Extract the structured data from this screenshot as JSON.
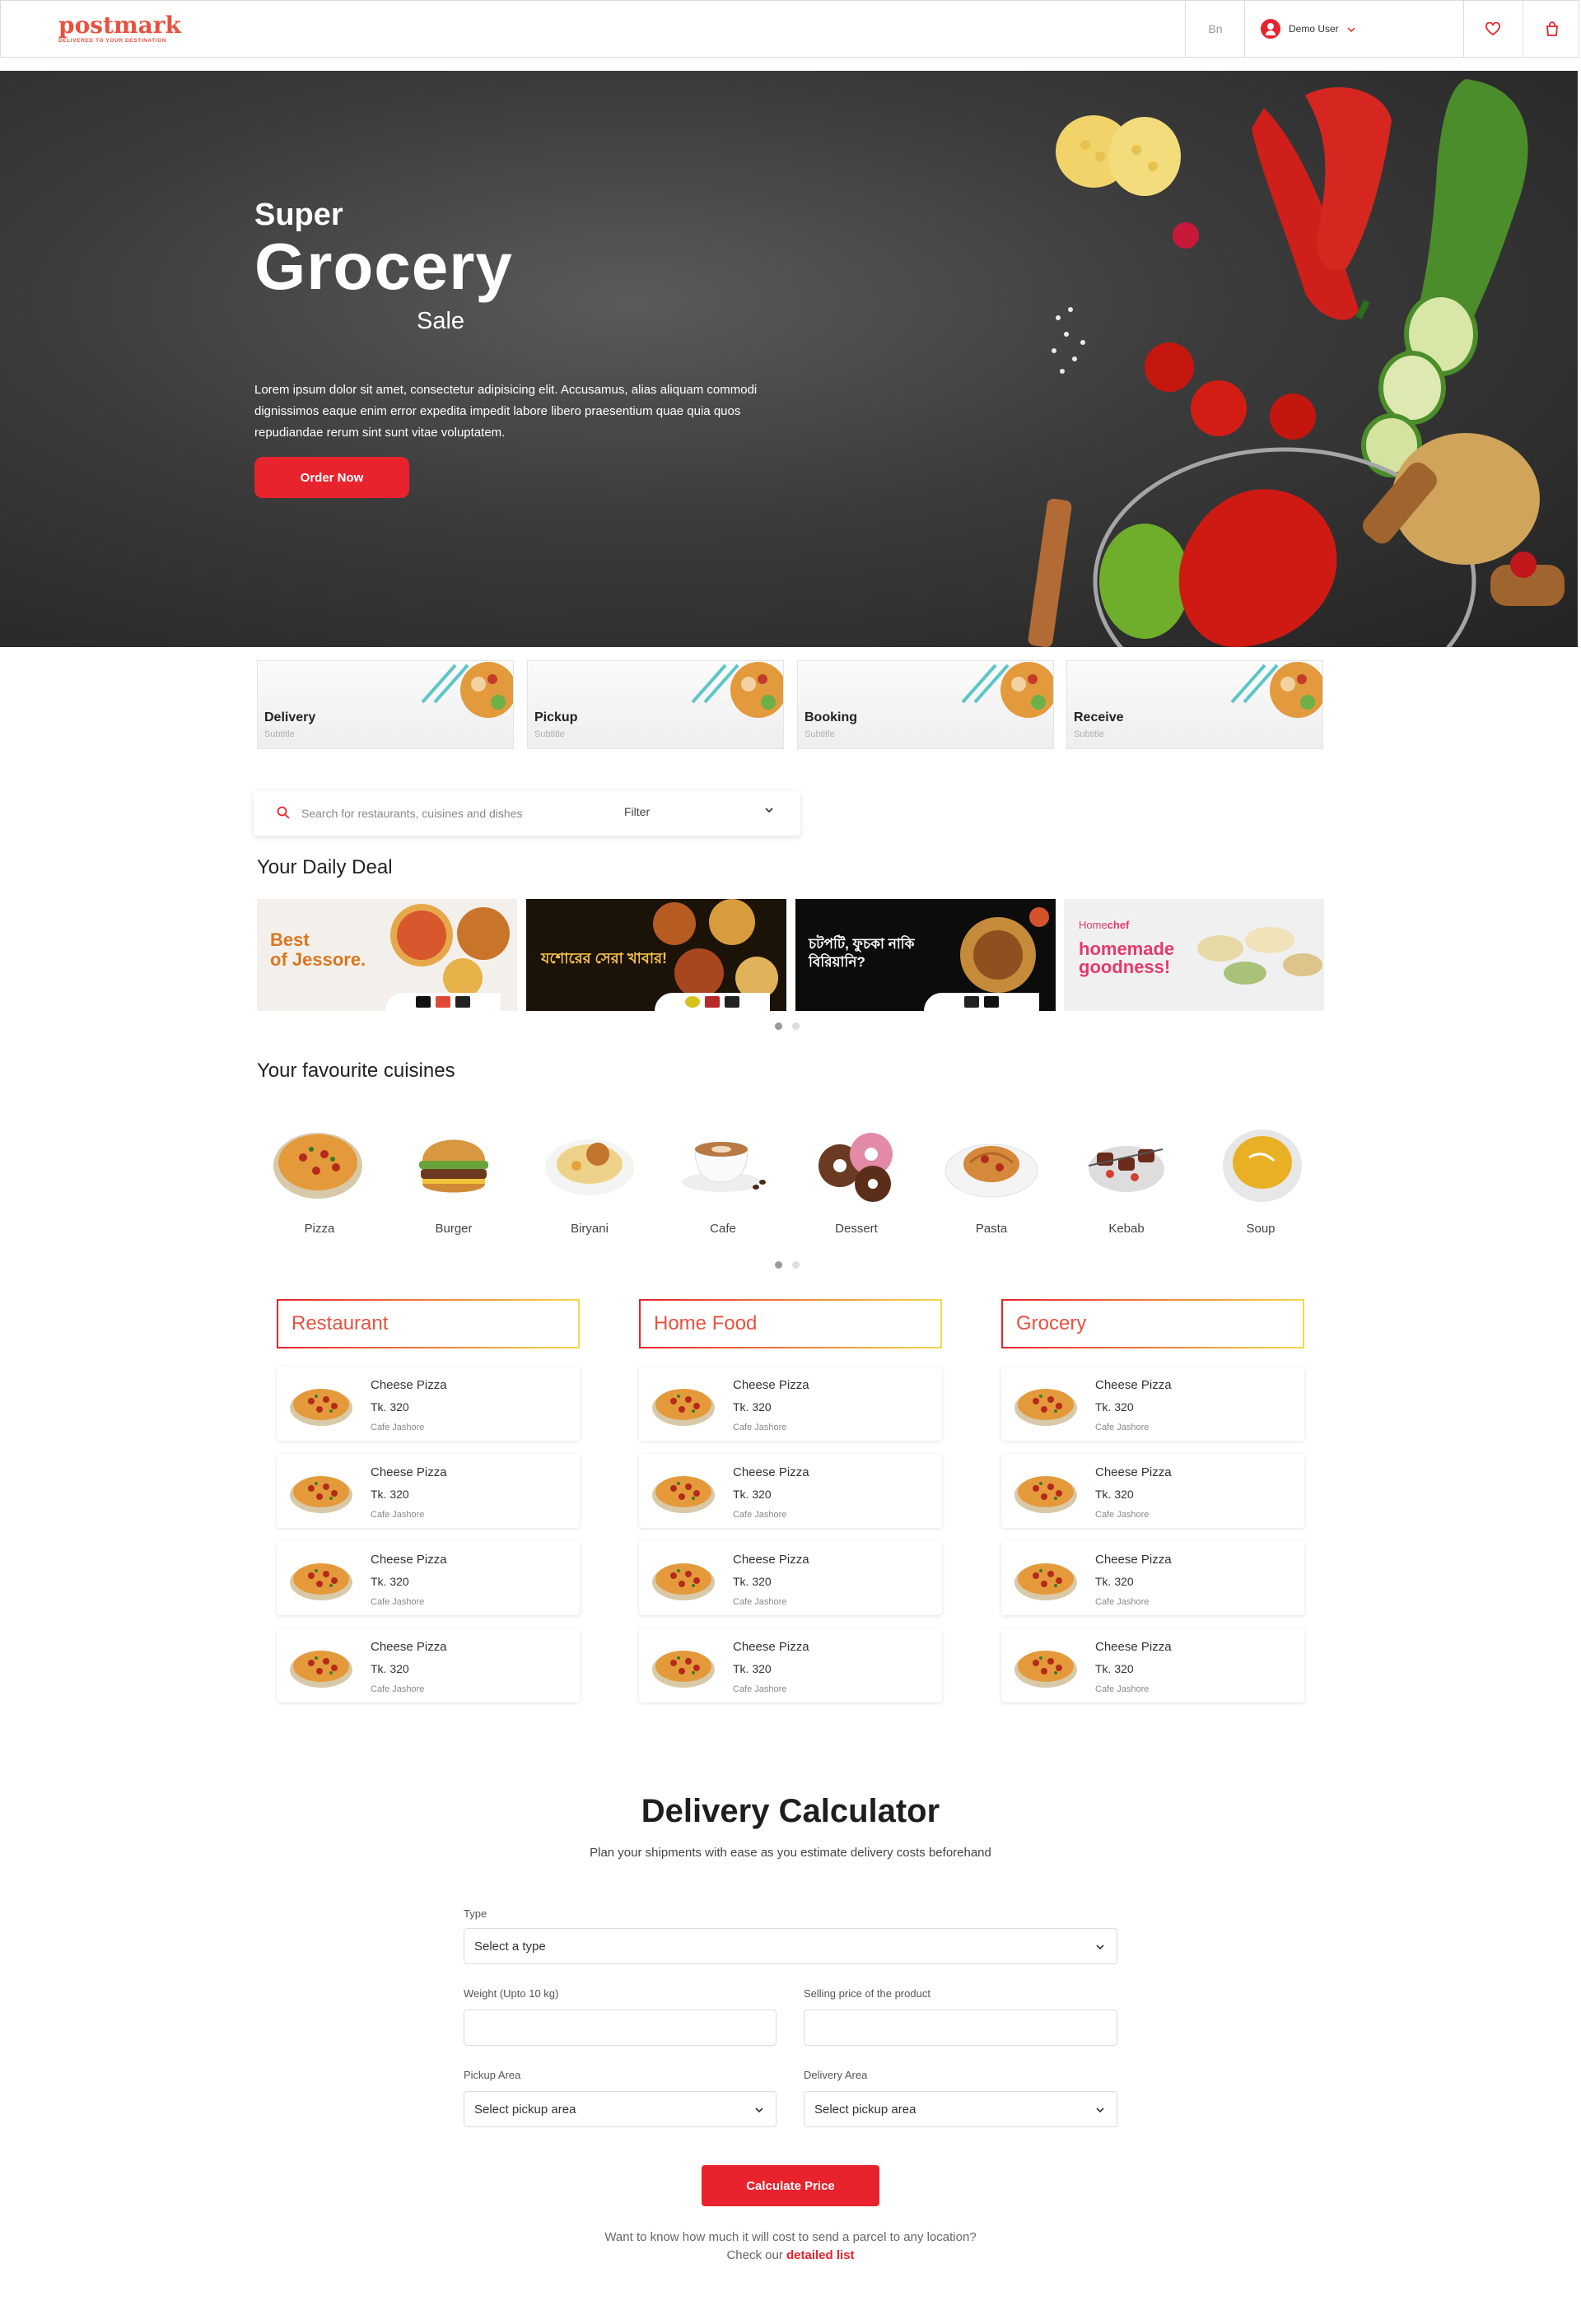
{
  "header": {
    "logo_word": "postmark",
    "logo_tagline": "DELIVERED TO YOUR DESTINATION",
    "language": "Bn",
    "user_name": "Demo User",
    "brand_color": "#e8232e",
    "icons": [
      "user-icon",
      "chevron-down-icon",
      "heart-icon",
      "shopping-bag-icon"
    ]
  },
  "hero": {
    "title_1": "Super",
    "title_2": "Grocery",
    "title_3": "Sale",
    "description": "Lorem ipsum dolor sit amet, consectetur adipisicing elit. Accusamus, alias aliquam commodi dignissimos eaque enim error expedita impedit labore libero praesentium quae quia quos repudiandae rerum sint sunt vitae voluptatem.",
    "cta": "Order Now"
  },
  "services": [
    {
      "title": "Delivery",
      "subtitle": "Subtitle"
    },
    {
      "title": "Pickup",
      "subtitle": "Subtitle"
    },
    {
      "title": "Booking",
      "subtitle": "Subtitle"
    },
    {
      "title": "Receive",
      "subtitle": "Subtitle"
    }
  ],
  "search": {
    "placeholder": "Search for restaurants, cuisines and dishes",
    "filter_label": "Filter"
  },
  "daily_deal": {
    "title": "Your Daily Deal",
    "banners": [
      {
        "text": "Best of Jessore.",
        "line_1": "Best",
        "line_2": "of Jessore."
      },
      {
        "text": "যশোরের সেরা খাবার!"
      },
      {
        "text": "চটপটি, ফুচকা নাকি বিরিয়ানি?",
        "line_1": "চটপটি, ফুচকা নাকি",
        "line_2": "বিরিয়ানি?"
      },
      {
        "brand": "Homechef",
        "brand_a": "Home",
        "brand_b": "chef",
        "text": "homemade goodness!",
        "line_1": "homemade",
        "line_2": "goodness!"
      }
    ],
    "carousel_active": 1,
    "carousel_count": 2
  },
  "cuisines": {
    "title": "Your favourite cuisines",
    "items": [
      "Pizza",
      "Burger",
      "Biryani",
      "Cafe",
      "Dessert",
      "Pasta",
      "Kebab",
      "Soup"
    ],
    "carousel_active": 1,
    "carousel_count": 2
  },
  "columns": [
    {
      "title": "Restaurant",
      "items": [
        {
          "name": "Cheese Pizza",
          "price": "Tk. 320",
          "shop": "Cafe Jashore"
        },
        {
          "name": "Cheese Pizza",
          "price": "Tk. 320",
          "shop": "Cafe Jashore"
        },
        {
          "name": "Cheese Pizza",
          "price": "Tk. 320",
          "shop": "Cafe Jashore"
        },
        {
          "name": "Cheese Pizza",
          "price": "Tk. 320",
          "shop": "Cafe Jashore"
        }
      ]
    },
    {
      "title": "Home Food",
      "items": [
        {
          "name": "Cheese Pizza",
          "price": "Tk. 320",
          "shop": "Cafe Jashore"
        },
        {
          "name": "Cheese Pizza",
          "price": "Tk. 320",
          "shop": "Cafe Jashore"
        },
        {
          "name": "Cheese Pizza",
          "price": "Tk. 320",
          "shop": "Cafe Jashore"
        },
        {
          "name": "Cheese Pizza",
          "price": "Tk. 320",
          "shop": "Cafe Jashore"
        }
      ]
    },
    {
      "title": "Grocery",
      "items": [
        {
          "name": "Cheese Pizza",
          "price": "Tk. 320",
          "shop": "Cafe Jashore"
        },
        {
          "name": "Cheese Pizza",
          "price": "Tk. 320",
          "shop": "Cafe Jashore"
        },
        {
          "name": "Cheese Pizza",
          "price": "Tk. 320",
          "shop": "Cafe Jashore"
        },
        {
          "name": "Cheese Pizza",
          "price": "Tk. 320",
          "shop": "Cafe Jashore"
        }
      ]
    }
  ],
  "calculator": {
    "title": "Delivery Calculator",
    "subtitle": "Plan your shipments with ease as you estimate delivery costs beforehand",
    "type_label": "Type",
    "type_value": "Select a type",
    "weight_label": "Weight (Upto 10 kg)",
    "weight_value": "",
    "price_label": "Selling price of the product",
    "price_value": "",
    "pickup_label": "Pickup Area",
    "pickup_value": "Select pickup area",
    "delivery_label": "Delivery Area",
    "delivery_value": "Select pickup area",
    "button": "Calculate Price",
    "note_line_1": "Want to know how much it will cost to send a parcel to any location?",
    "note_prefix": "Check our",
    "note_link": "detailed list"
  }
}
